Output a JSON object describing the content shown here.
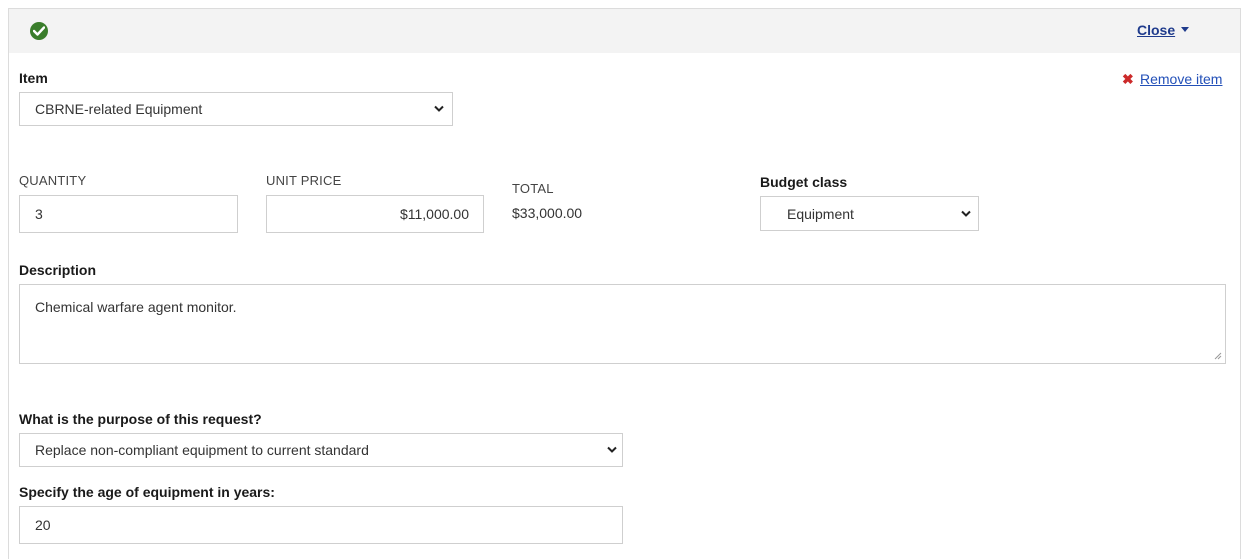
{
  "header": {
    "status_icon": "check-circle-icon",
    "close_label": "Close"
  },
  "item": {
    "label": "Item",
    "selected": "CBRNE-related Equipment",
    "remove_label": "Remove item"
  },
  "quantity": {
    "label": "QUANTITY",
    "value": "3"
  },
  "unit_price": {
    "label": "UNIT PRICE",
    "value": "$11,000.00"
  },
  "total": {
    "label": "TOTAL",
    "value": "$33,000.00"
  },
  "budget_class": {
    "label": "Budget class",
    "selected": "Equipment"
  },
  "description": {
    "label": "Description",
    "value": "Chemical warfare agent monitor."
  },
  "purpose": {
    "label": "What is the purpose of this request?",
    "selected": "Replace non-compliant equipment to current standard"
  },
  "age": {
    "label": "Specify the age of equipment in years:",
    "value": "20"
  },
  "colors": {
    "accent_link": "#1f3b8c",
    "success": "#3a7d2b",
    "danger": "#cc2a2a"
  }
}
